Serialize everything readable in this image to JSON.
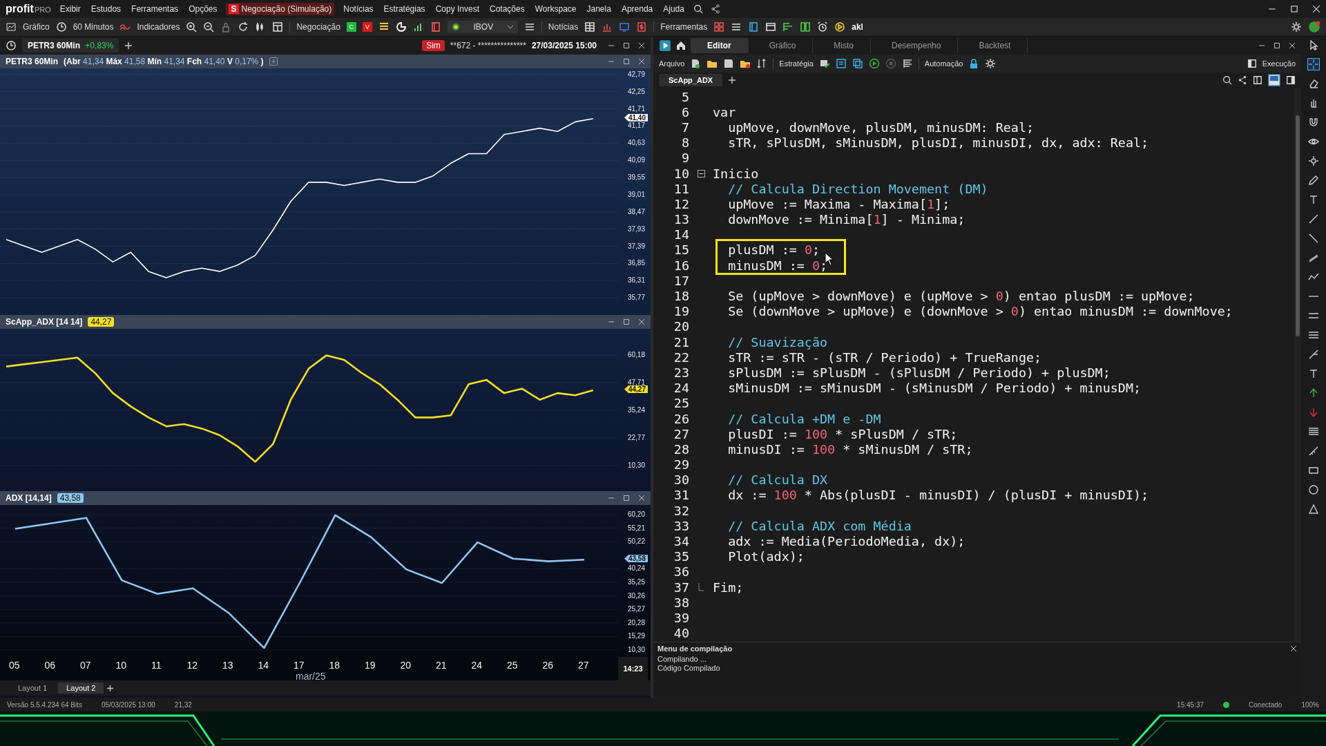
{
  "app": {
    "logo": "profit",
    "logo_suffix": "PRO"
  },
  "menu": [
    {
      "label": "Exibir",
      "selected": false
    },
    {
      "label": "Estudos",
      "selected": false
    },
    {
      "label": "Ferramentas",
      "selected": false
    },
    {
      "label": "Opções",
      "selected": false
    },
    {
      "label": "Negociação (Simulação)",
      "badge": "S",
      "selected": true
    },
    {
      "label": "Notícias",
      "selected": false
    },
    {
      "label": "Estratégias",
      "selected": false
    },
    {
      "label": "Copy Invest",
      "selected": false
    },
    {
      "label": "Cotações",
      "selected": false
    },
    {
      "label": "Workspace",
      "selected": false
    },
    {
      "label": "Janela",
      "selected": false
    },
    {
      "label": "Aprenda",
      "selected": false
    },
    {
      "label": "Ajuda",
      "selected": false
    }
  ],
  "toolbar": {
    "chart": "Gráfico",
    "interval": "60 Minutos",
    "indicators": "Indicadores",
    "trading": "Negociação",
    "buy": "C",
    "sell": "V",
    "index": "IBOV",
    "news": "Notícias",
    "tools": "Ferramentas",
    "akl": "akl"
  },
  "chart_tab": {
    "label": "PETR3 60Min",
    "change": "+0,83%",
    "mode": "Sim",
    "account": "**672 - ***************",
    "datetime": "27/03/2025 15:00"
  },
  "panes": [
    {
      "kind": "price",
      "title": "PETR3 60Min",
      "legend": [
        {
          "label": "(Abr",
          "value": "41,34"
        },
        {
          "label": "Máx",
          "value": "41,58"
        },
        {
          "label": "Mín",
          "value": "41,34"
        },
        {
          "label": "Fch",
          "value": "41,40"
        },
        {
          "label": "V",
          "value": "0,17%"
        }
      ],
      "legend_end": ")",
      "tag": "41,40",
      "chart_data": {
        "type": "line",
        "grid": true,
        "ylim": [
          35.23,
          42.98
        ],
        "yticks": [
          {
            "value": 42.79,
            "label": "42,79"
          },
          {
            "value": 42.25,
            "label": "42,25"
          },
          {
            "value": 41.71,
            "label": "41,71"
          },
          {
            "value": 41.17,
            "label": "41,17"
          },
          {
            "value": 40.63,
            "label": "40,63"
          },
          {
            "value": 40.09,
            "label": "40,09"
          },
          {
            "value": 39.55,
            "label": "39,55"
          },
          {
            "value": 39.01,
            "label": "39,01"
          },
          {
            "value": 38.47,
            "label": "38,47"
          },
          {
            "value": 37.93,
            "label": "37,93"
          },
          {
            "value": 37.39,
            "label": "37,39"
          },
          {
            "value": 36.85,
            "label": "36,85"
          },
          {
            "value": 36.31,
            "label": "36,31"
          },
          {
            "value": 35.77,
            "label": "35,77"
          }
        ],
        "series": [
          {
            "color": "#ffffff",
            "values": [
              37.6,
              37.4,
              37.2,
              37.4,
              37.6,
              37.3,
              36.9,
              37.2,
              36.6,
              36.4,
              36.6,
              36.7,
              36.6,
              36.8,
              37.1,
              37.9,
              38.8,
              39.4,
              39.4,
              39.3,
              39.4,
              39.5,
              39.4,
              39.4,
              39.6,
              40.0,
              40.3,
              40.3,
              40.9,
              41.0,
              41.1,
              41.0,
              41.3,
              41.4
            ]
          }
        ]
      }
    },
    {
      "kind": "indicator",
      "title": "ScApp_ADX [14 14]",
      "badge": "44,27",
      "tag": "44,27",
      "chart_data": {
        "type": "line",
        "grid": true,
        "ylim": [
          -1.24,
          72.03
        ],
        "yticks": [
          {
            "value": 60.18,
            "label": "60,18"
          },
          {
            "value": 47.71,
            "label": "47,71"
          },
          {
            "value": 35.24,
            "label": "35,24"
          },
          {
            "value": 22.77,
            "label": "22,77"
          },
          {
            "value": 10.3,
            "label": "10,30"
          }
        ],
        "series": [
          {
            "color": "#f5e020",
            "values": [
              55,
              56,
              57,
              58,
              59,
              52,
              43,
              37,
              32,
              28,
              29,
              27,
              24,
              19,
              12,
              20,
              40,
              54,
              60,
              58,
              52,
              47,
              40,
              32,
              32,
              33,
              47,
              49,
              43,
              45,
              40,
              43,
              42,
              44.3
            ]
          }
        ]
      }
    },
    {
      "kind": "indicator",
      "title": "ADX [14,14]",
      "badge": "43,58",
      "tag": "43,58",
      "chart_data": {
        "type": "line",
        "grid": true,
        "ylim": [
          7.73,
          63.8
        ],
        "categories": [
          "05",
          "06",
          "07",
          "10",
          "11",
          "12",
          "13",
          "14",
          "17",
          "18",
          "19",
          "20",
          "21",
          "24",
          "25",
          "26",
          "27"
        ],
        "yticks": [
          {
            "value": 60.2,
            "label": "60,20"
          },
          {
            "value": 55.21,
            "label": "55,21"
          },
          {
            "value": 50.22,
            "label": "50,22"
          },
          {
            "value": 40.24,
            "label": "40,24"
          },
          {
            "value": 35.25,
            "label": "35,25"
          },
          {
            "value": 30.26,
            "label": "30,26"
          },
          {
            "value": 25.27,
            "label": "25,27"
          },
          {
            "value": 20.28,
            "label": "20,28"
          },
          {
            "value": 15.29,
            "label": "15,29"
          },
          {
            "value": 10.3,
            "label": "10,30"
          }
        ],
        "series": [
          {
            "color": "#8ec8f0",
            "values": [
              55,
              57,
              59,
              36,
              31,
              33,
              24,
              11,
              35,
              60,
              52,
              40,
              35,
              50,
              44,
              43,
              43.6
            ]
          }
        ]
      }
    }
  ],
  "x_axis": {
    "month": "mar/25",
    "time": "14:23"
  },
  "layouts": [
    {
      "label": "Layout 1",
      "selected": false
    },
    {
      "label": "Layout 2",
      "selected": true
    }
  ],
  "editor_tabs": [
    {
      "label": "Editor",
      "selected": true
    },
    {
      "label": "Gráfico",
      "selected": false
    },
    {
      "label": "Misto",
      "selected": false
    },
    {
      "label": "Desempenho",
      "selected": false
    },
    {
      "label": "Backtest",
      "selected": false
    }
  ],
  "editor_toolbar": {
    "file": "Arquivo",
    "strategy": "Estratégia",
    "automation": "Automação",
    "execution": "Execução"
  },
  "file_tab": "ScApp_ADX",
  "code_lines": [
    {
      "number": "5",
      "kind": "plain",
      "boxed": false
    },
    {
      "number": "6",
      "kind": "plain",
      "boxed": false,
      "segments": [
        {
          "text": "var",
          "kind": "code"
        }
      ]
    },
    {
      "number": "7",
      "kind": "plain",
      "boxed": false,
      "segments": [
        {
          "text": "  upMove, downMove, plusDM, minusDM: Real;",
          "kind": "code"
        }
      ]
    },
    {
      "number": "8",
      "kind": "plain",
      "boxed": false,
      "segments": [
        {
          "text": "  sTR, sPlusDM, sMinusDM, plusDI, minusDI, dx, adx: Real;",
          "kind": "code"
        }
      ]
    },
    {
      "number": "9",
      "kind": "plain",
      "boxed": false
    },
    {
      "number": "10",
      "kind": "fold_start",
      "boxed": false,
      "segments": [
        {
          "text": "Inicio",
          "kind": "code"
        }
      ]
    },
    {
      "number": "11",
      "kind": "plain",
      "boxed": false,
      "segments": [
        {
          "text": "  // Calcula Direction Movement (DM)",
          "kind": "comment"
        }
      ]
    },
    {
      "number": "12",
      "kind": "plain",
      "boxed": false,
      "segments": [
        {
          "text": "  upMove := Maxima - Maxima[",
          "kind": "code"
        },
        {
          "text": "1",
          "kind": "number"
        },
        {
          "text": "];",
          "kind": "code"
        }
      ]
    },
    {
      "number": "13",
      "kind": "plain",
      "boxed": false,
      "segments": [
        {
          "text": "  downMove := Minima[",
          "kind": "code"
        },
        {
          "text": "1",
          "kind": "number"
        },
        {
          "text": "] - Minima;",
          "kind": "code"
        }
      ]
    },
    {
      "number": "14",
      "kind": "plain",
      "boxed": false
    },
    {
      "number": "15",
      "kind": "plain",
      "boxed": true,
      "segments": [
        {
          "text": "  plusDM := ",
          "kind": "code"
        },
        {
          "text": "0",
          "kind": "number"
        },
        {
          "text": ";",
          "kind": "code"
        }
      ]
    },
    {
      "number": "16",
      "kind": "plain",
      "boxed": true,
      "segments": [
        {
          "text": "  minusDM := ",
          "kind": "code"
        },
        {
          "text": "0",
          "kind": "number"
        },
        {
          "text": ";",
          "kind": "code"
        }
      ]
    },
    {
      "number": "17",
      "kind": "plain",
      "boxed": false
    },
    {
      "number": "18",
      "kind": "plain",
      "boxed": false,
      "segments": [
        {
          "text": "  Se (upMove > downMove) e (upMove > ",
          "kind": "code"
        },
        {
          "text": "0",
          "kind": "number"
        },
        {
          "text": ") entao plusDM := upMove;",
          "kind": "code"
        }
      ]
    },
    {
      "number": "19",
      "kind": "plain",
      "boxed": false,
      "segments": [
        {
          "text": "  Se (downMove > upMove) e (downMove > ",
          "kind": "code"
        },
        {
          "text": "0",
          "kind": "number"
        },
        {
          "text": ") entao minusDM := downMove;",
          "kind": "code"
        }
      ]
    },
    {
      "number": "20",
      "kind": "plain",
      "boxed": false
    },
    {
      "number": "21",
      "kind": "plain",
      "boxed": false,
      "segments": [
        {
          "text": "  // Suavização",
          "kind": "comment"
        }
      ]
    },
    {
      "number": "22",
      "kind": "plain",
      "boxed": false,
      "segments": [
        {
          "text": "  sTR := sTR - (sTR / Periodo) + TrueRange;",
          "kind": "code"
        }
      ]
    },
    {
      "number": "23",
      "kind": "plain",
      "boxed": false,
      "segments": [
        {
          "text": "  sPlusDM := sPlusDM - (sPlusDM / Periodo) + plusDM;",
          "kind": "code"
        }
      ]
    },
    {
      "number": "24",
      "kind": "plain",
      "boxed": false,
      "segments": [
        {
          "text": "  sMinusDM := sMinusDM - (sMinusDM / Periodo) + minusDM;",
          "kind": "code"
        }
      ]
    },
    {
      "number": "25",
      "kind": "plain",
      "boxed": false
    },
    {
      "number": "26",
      "kind": "plain",
      "boxed": false,
      "segments": [
        {
          "text": "  // Calcula +DM e -DM",
          "kind": "comment"
        }
      ]
    },
    {
      "number": "27",
      "kind": "plain",
      "boxed": false,
      "segments": [
        {
          "text": "  plusDI := ",
          "kind": "code"
        },
        {
          "text": "100",
          "kind": "number"
        },
        {
          "text": " * sPlusDM / sTR;",
          "kind": "code"
        }
      ]
    },
    {
      "number": "28",
      "kind": "plain",
      "boxed": false,
      "segments": [
        {
          "text": "  minusDI := ",
          "kind": "code"
        },
        {
          "text": "100",
          "kind": "number"
        },
        {
          "text": " * sMinusDM / sTR;",
          "kind": "code"
        }
      ]
    },
    {
      "number": "29",
      "kind": "plain",
      "boxed": false
    },
    {
      "number": "30",
      "kind": "plain",
      "boxed": false,
      "segments": [
        {
          "text": "  // Calcula DX",
          "kind": "comment"
        }
      ]
    },
    {
      "number": "31",
      "kind": "plain",
      "boxed": false,
      "segments": [
        {
          "text": "  dx := ",
          "kind": "code"
        },
        {
          "text": "100",
          "kind": "number"
        },
        {
          "text": " * Abs(plusDI - minusDI) / (plusDI + minusDI);",
          "kind": "code"
        }
      ]
    },
    {
      "number": "32",
      "kind": "plain",
      "boxed": false
    },
    {
      "number": "33",
      "kind": "plain",
      "boxed": false,
      "segments": [
        {
          "text": "  // Calcula ADX com Média",
          "kind": "comment"
        }
      ]
    },
    {
      "number": "34",
      "kind": "plain",
      "boxed": false,
      "segments": [
        {
          "text": "  adx := Media(PeriodoMedia, dx);",
          "kind": "code"
        }
      ]
    },
    {
      "number": "35",
      "kind": "plain",
      "boxed": false,
      "segments": [
        {
          "text": "  Plot(adx);",
          "kind": "code"
        }
      ]
    },
    {
      "number": "36",
      "kind": "plain",
      "boxed": false
    },
    {
      "number": "37",
      "kind": "fold_end",
      "boxed": false,
      "segments": [
        {
          "text": "Fim;",
          "kind": "code"
        }
      ]
    },
    {
      "number": "38",
      "kind": "plain",
      "boxed": false
    },
    {
      "number": "39",
      "kind": "plain",
      "boxed": false
    },
    {
      "number": "40",
      "kind": "plain",
      "boxed": false
    }
  ],
  "compile_panel": {
    "title": "Menu de compilação",
    "messages": [
      "Compilando ...",
      "Código Compilado"
    ]
  },
  "status_bar": {
    "version": "Versão 5.5.4.234 64 Bits",
    "datetime": "05/03/2025 13:00",
    "value": "21,32",
    "clock": "15:45:37",
    "connection": "Conectado",
    "zoom": "100%"
  }
}
